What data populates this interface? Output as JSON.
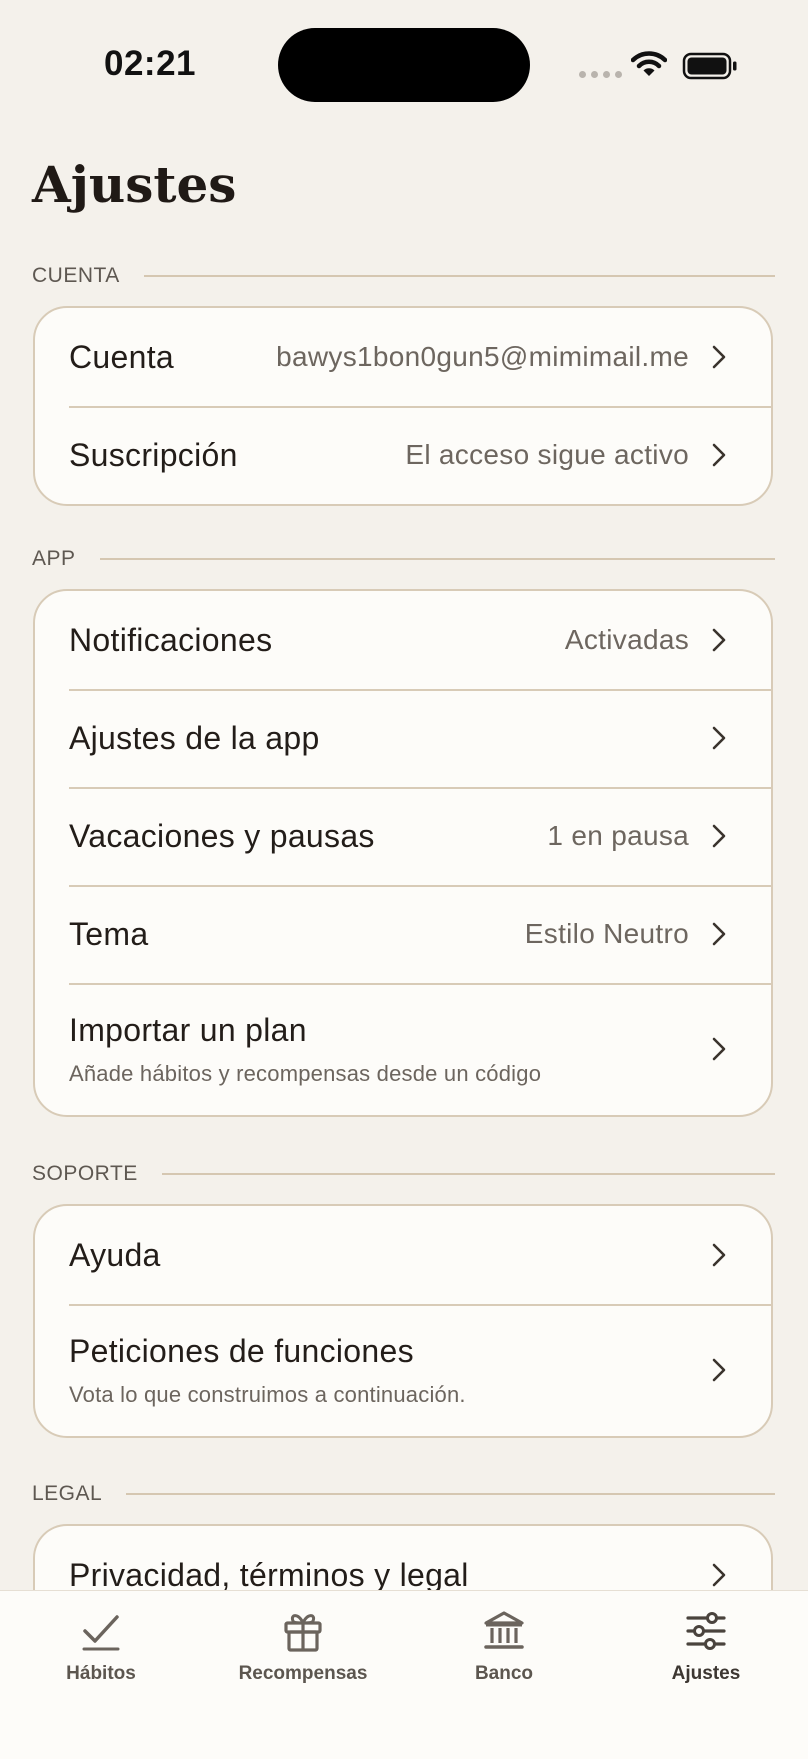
{
  "status_bar": {
    "time": "02:21"
  },
  "page": {
    "title": "Ajustes"
  },
  "sections": {
    "cuenta": {
      "label": "CUENTA",
      "rows": [
        {
          "title": "Cuenta",
          "value": "bawys1bon0gun5@mimimail.me"
        },
        {
          "title": "Suscripción",
          "value": "El acceso sigue activo"
        }
      ]
    },
    "app": {
      "label": "APP",
      "rows": [
        {
          "title": "Notificaciones",
          "value": "Activadas"
        },
        {
          "title": "Ajustes de la app"
        },
        {
          "title": "Vacaciones y pausas",
          "value": "1 en pausa"
        },
        {
          "title": "Tema",
          "value": "Estilo Neutro"
        },
        {
          "title": "Importar un plan",
          "subtitle": "Añade hábitos y recompensas desde un código"
        }
      ]
    },
    "soporte": {
      "label": "SOPORTE",
      "rows": [
        {
          "title": "Ayuda"
        },
        {
          "title": "Peticiones de funciones",
          "subtitle": "Vota lo que construimos a continuación."
        }
      ]
    },
    "legal": {
      "label": "LEGAL",
      "rows": [
        {
          "title": "Privacidad, términos y legal"
        }
      ]
    }
  },
  "tabbar": {
    "items": [
      {
        "label": "Hábitos",
        "icon": "checkmark-icon"
      },
      {
        "label": "Recompensas",
        "icon": "gift-icon"
      },
      {
        "label": "Banco",
        "icon": "bank-icon"
      },
      {
        "label": "Ajustes",
        "icon": "sliders-icon",
        "active": true
      }
    ]
  },
  "colors": {
    "background": "#f4f1eb",
    "card": "#fdfcf9",
    "border": "#d8cbb7",
    "text": "#231d19",
    "secondary_text": "#6d665f"
  }
}
